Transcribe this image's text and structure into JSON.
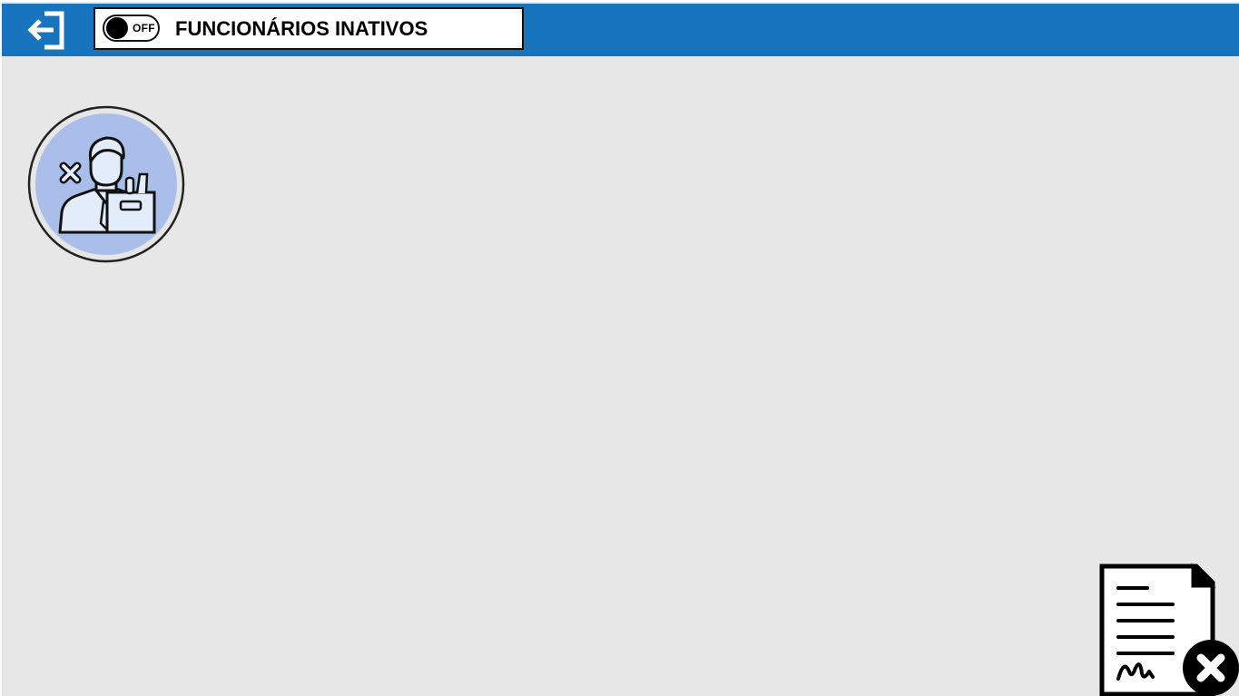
{
  "header": {
    "exit_icon": "exit-arrow-icon",
    "toggle": {
      "state_label": "OFF",
      "title": "FUNCIONÁRIOS INATIVOS"
    }
  },
  "colors": {
    "topbar": "#1874bd",
    "background": "#e7e7e7",
    "avatar_fill": "#a9bfea"
  },
  "main": {
    "employee_card_icon": "dismissed-employee-icon"
  },
  "footer": {
    "document_icon": "document-cancel-icon"
  }
}
